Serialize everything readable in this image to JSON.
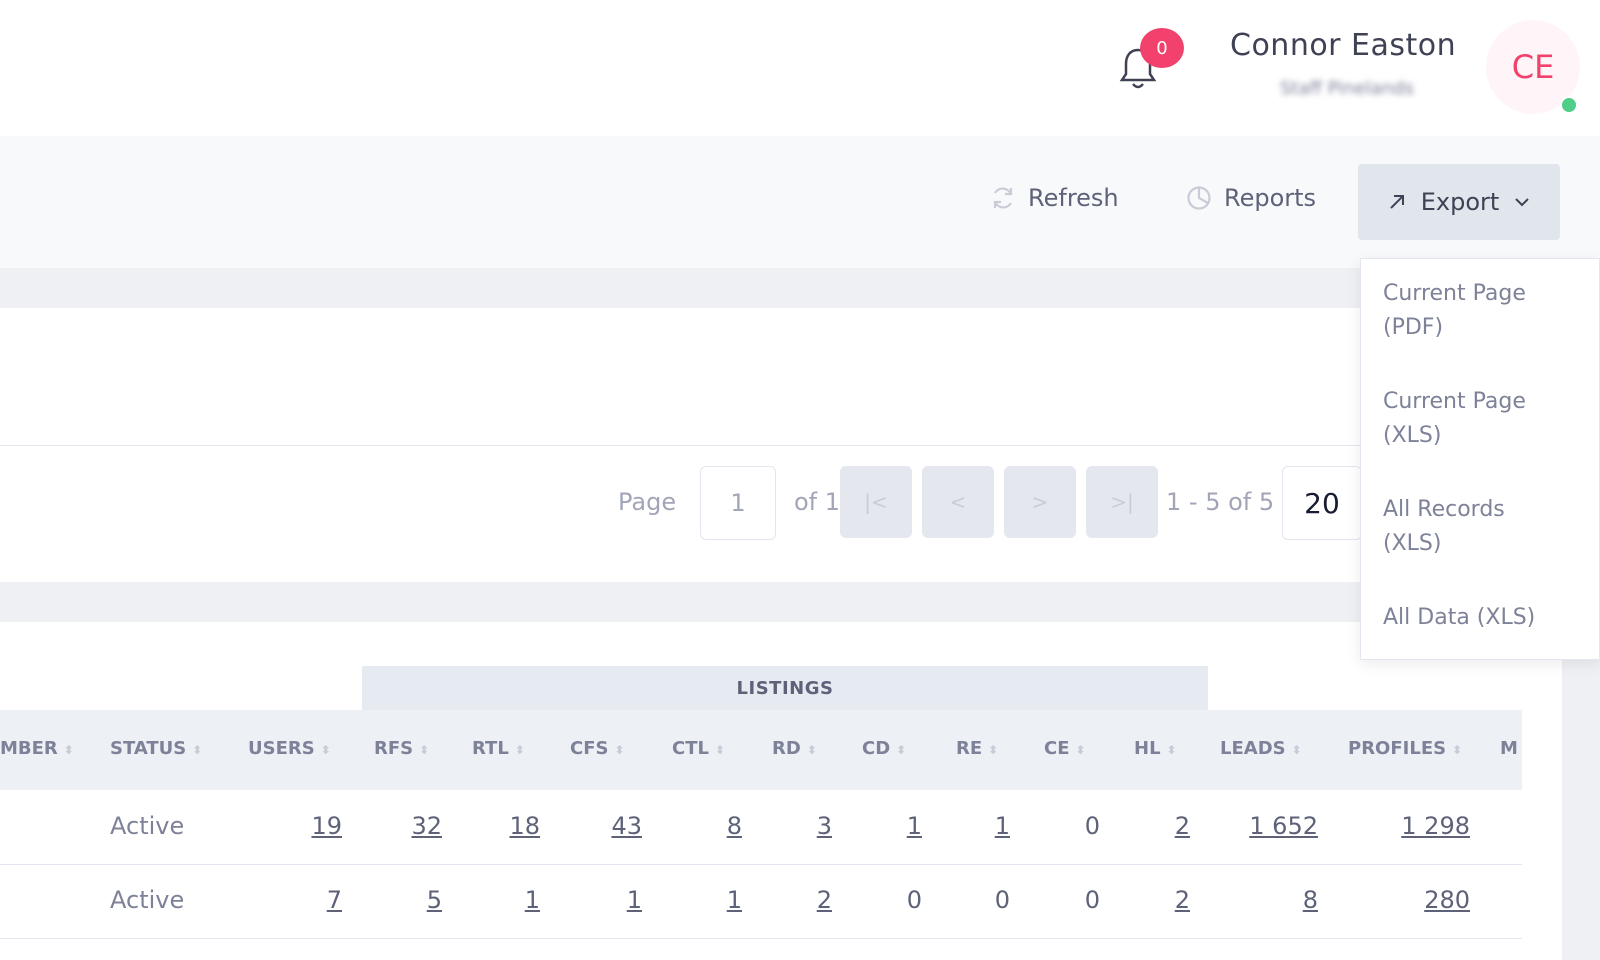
{
  "header": {
    "notification_count": "0",
    "user_name": "Connor Easton",
    "user_subtitle": "Staff Pinelands",
    "avatar_initials": "CE"
  },
  "toolbar": {
    "refresh_label": "Refresh",
    "reports_label": "Reports",
    "export_label": "Export"
  },
  "export_menu": [
    {
      "line1": "Current Page",
      "line2": "(PDF)"
    },
    {
      "line1": "Current Page",
      "line2": "(XLS)"
    },
    {
      "line1": "All Records",
      "line2": "(XLS)"
    },
    {
      "line1": "All Data (XLS)",
      "line2": ""
    }
  ],
  "pager": {
    "page_label": "Page",
    "current_page": "1",
    "of_label": "of 1",
    "range_label": "1 - 5 of 5",
    "page_size": "20"
  },
  "table": {
    "group_header": "LISTINGS",
    "columns": [
      "MBER",
      "STATUS",
      "USERS",
      "RFS",
      "RTL",
      "CFS",
      "CTL",
      "RD",
      "CD",
      "RE",
      "CE",
      "HL",
      "LEADS",
      "PROFILES",
      "M"
    ],
    "rows": [
      {
        "status": "Active",
        "users": "19",
        "rfs": "32",
        "rtl": "18",
        "cfs": "43",
        "ctl": "8",
        "rd": "3",
        "cd": "1",
        "re": "1",
        "ce": "0",
        "hl": "2",
        "leads": "1 652",
        "profiles": "1 298"
      },
      {
        "status": "Active",
        "users": "7",
        "rfs": "5",
        "rtl": "1",
        "cfs": "1",
        "ctl": "1",
        "rd": "2",
        "cd": "0",
        "re": "0",
        "ce": "0",
        "hl": "2",
        "leads": "8",
        "profiles": "280"
      }
    ]
  },
  "colors": {
    "accent_red": "#f1416c",
    "online_green": "#50cd89",
    "export_bg": "#e1e5ec"
  }
}
